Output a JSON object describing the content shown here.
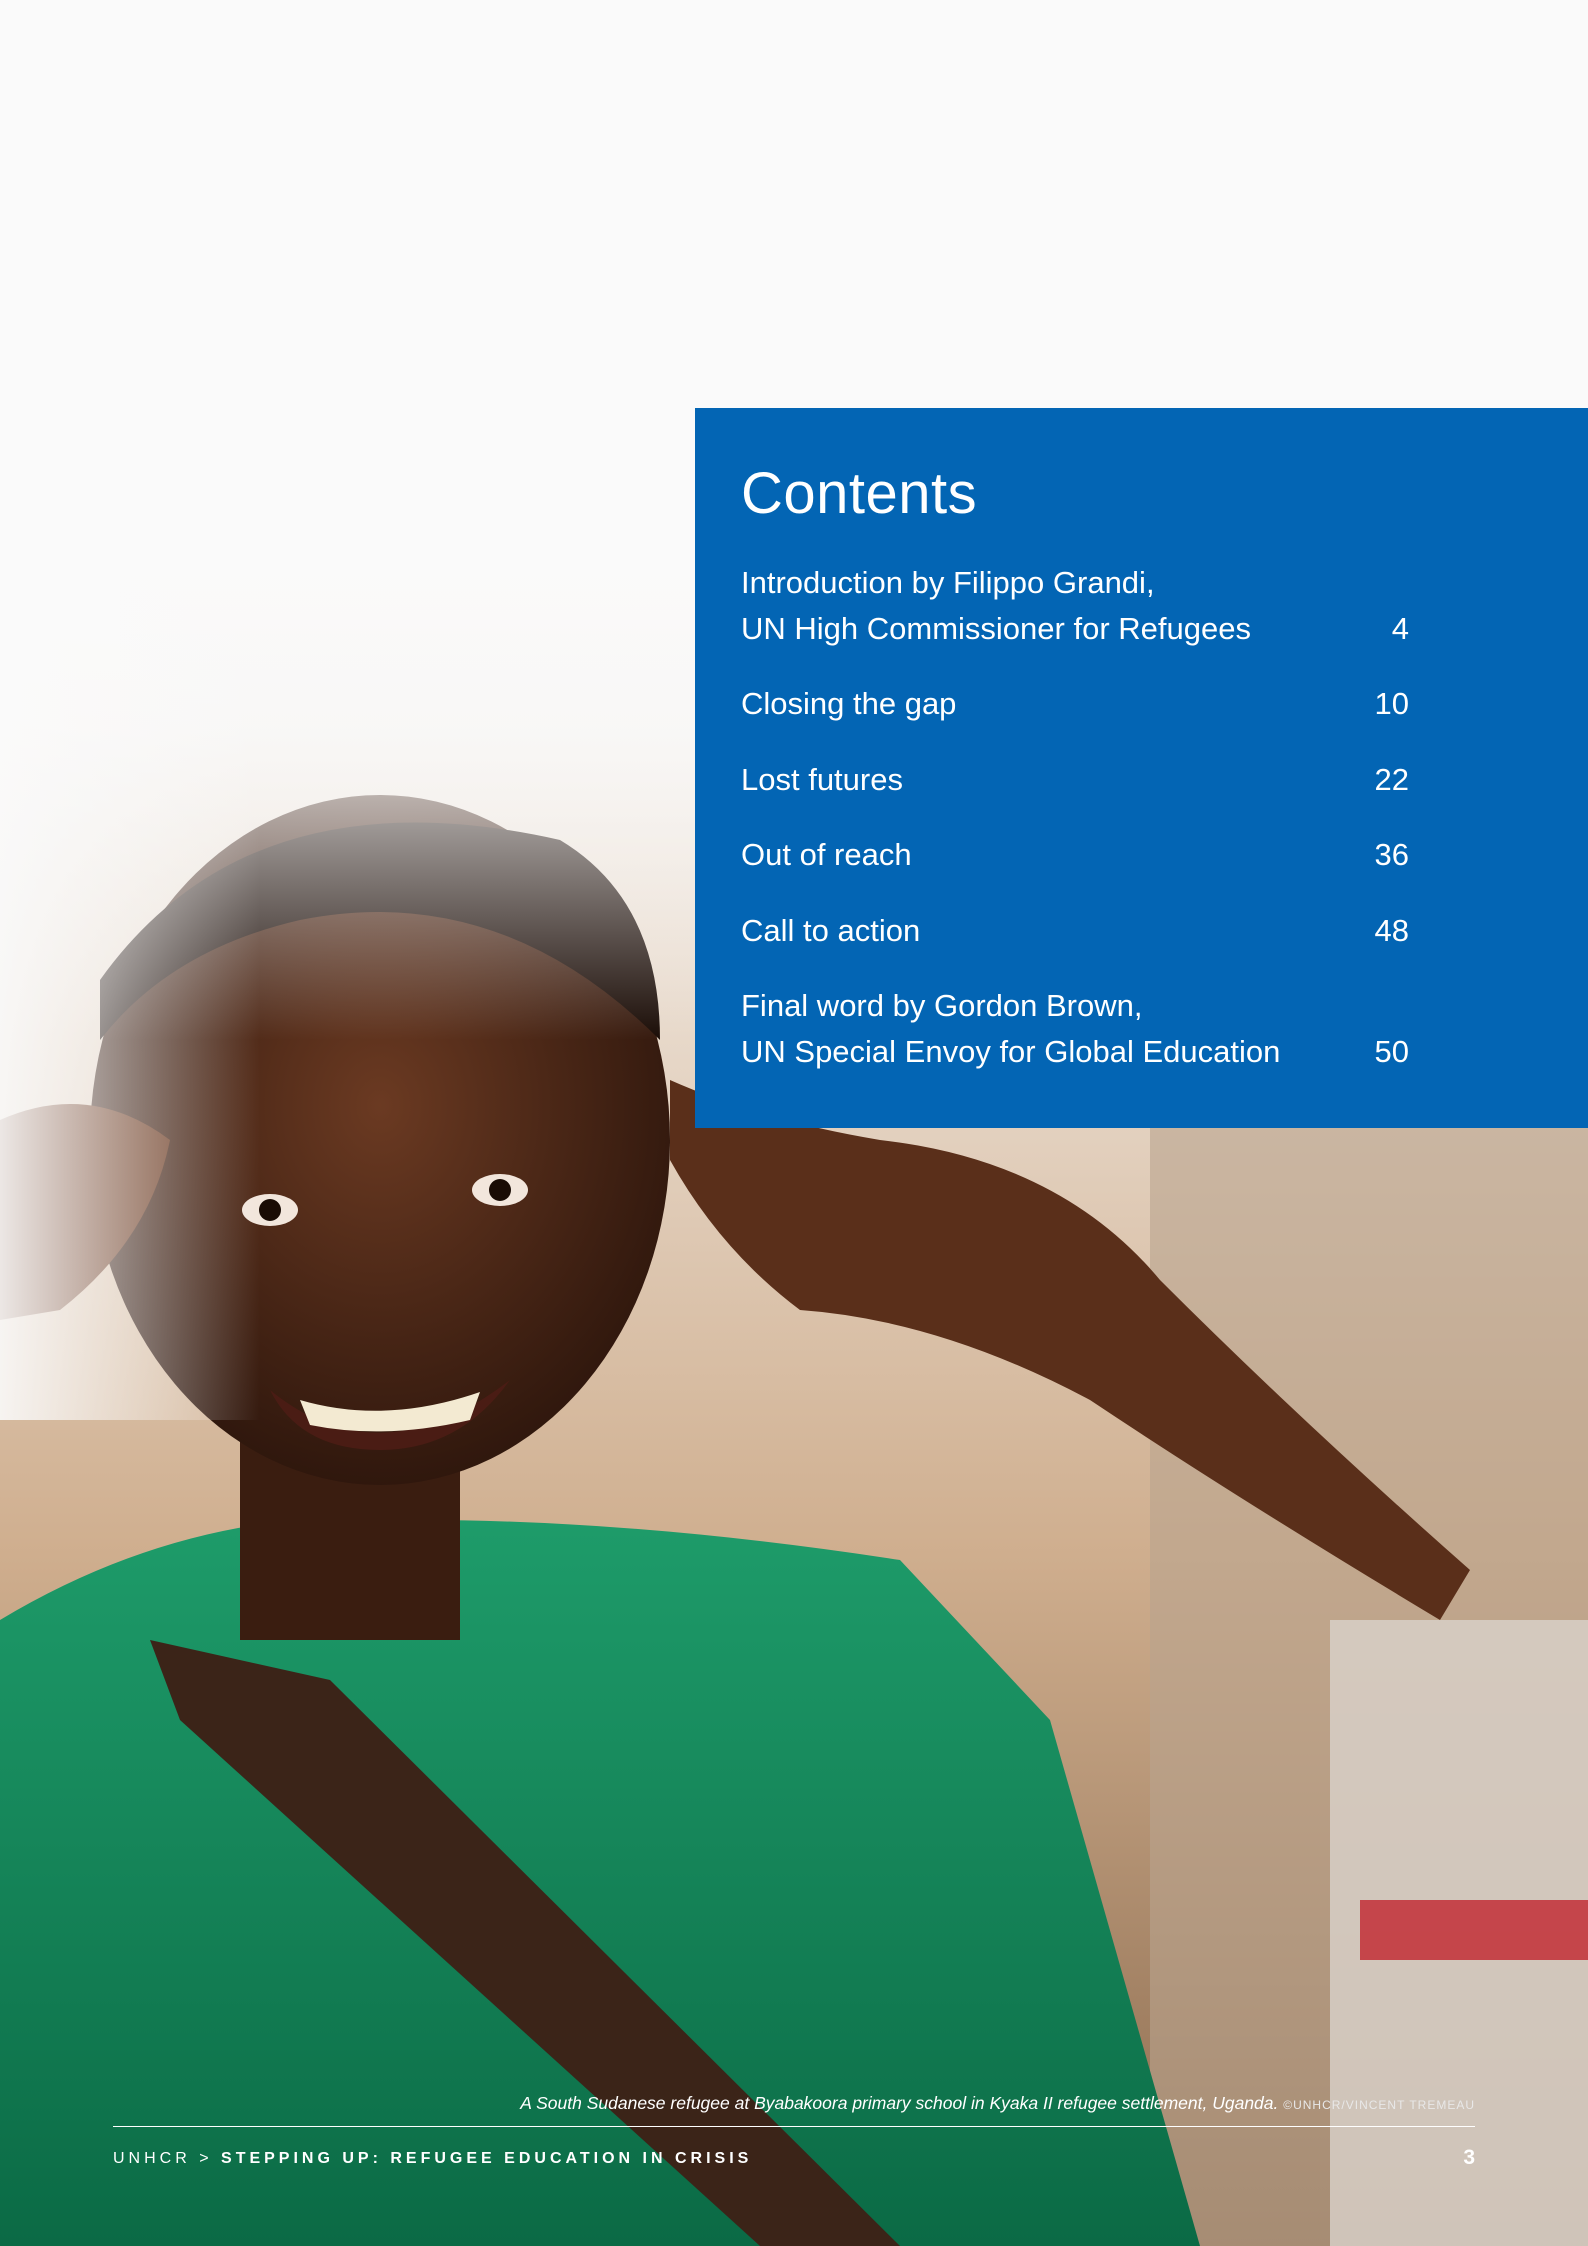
{
  "contents": {
    "title": "Contents",
    "entries": [
      {
        "label_line1": "Introduction by Filippo Grandi,",
        "label_line2": "UN High Commissioner for Refugees",
        "page": "4"
      },
      {
        "label": "Closing the gap",
        "page": "10"
      },
      {
        "label": "Lost futures",
        "page": "22"
      },
      {
        "label": "Out of reach",
        "page": "36"
      },
      {
        "label": "Call to action",
        "page": "48"
      },
      {
        "label_line1": "Final word by Gordon Brown,",
        "label_line2": "UN Special Envoy for Global Education",
        "page": "50"
      }
    ]
  },
  "caption": {
    "text": "A South Sudanese refugee at Byabakoora primary school in Kyaka II refugee settlement, Uganda.",
    "credit": "©UNHCR/VINCENT TREMEAU"
  },
  "footer": {
    "org": "UNHCR >",
    "publication": "STEPPING UP: REFUGEE EDUCATION IN CRISIS",
    "page_number": "3"
  },
  "colors": {
    "contents_box": "#0365b4",
    "text_on_blue": "#ffffff"
  }
}
